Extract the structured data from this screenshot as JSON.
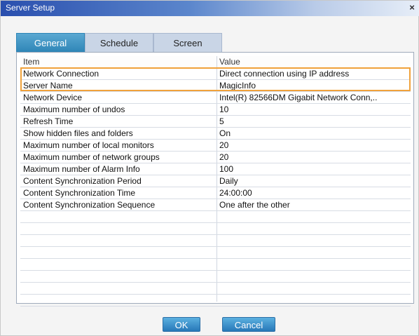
{
  "window": {
    "title": "Server Setup",
    "close_glyph": "×"
  },
  "tabs": [
    {
      "label": "General"
    },
    {
      "label": "Schedule"
    },
    {
      "label": "Screen"
    }
  ],
  "table": {
    "columns": [
      "Item",
      "Value"
    ],
    "rows": [
      {
        "item": "Network Connection",
        "value": "Direct connection using IP address"
      },
      {
        "item": "Server Name",
        "value": "MagicInfo"
      },
      {
        "item": "Network Device",
        "value": "Intel(R) 82566DM Gigabit Network Conn,.."
      },
      {
        "item": "Maximum number of undos",
        "value": "10"
      },
      {
        "item": "Refresh Time",
        "value": "5"
      },
      {
        "item": "Show hidden files and folders",
        "value": "On"
      },
      {
        "item": "Maximum number of local monitors",
        "value": "20"
      },
      {
        "item": "Maximum number of network groups",
        "value": "20"
      },
      {
        "item": "Maximum number of Alarm Info",
        "value": "100"
      },
      {
        "item": "Content Synchronization Period",
        "value": "Daily"
      },
      {
        "item": "Content Synchronization Time",
        "value": "24:00:00"
      },
      {
        "item": "Content Synchronization Sequence",
        "value": "One after the other"
      }
    ]
  },
  "buttons": {
    "ok": "OK",
    "cancel": "Cancel"
  },
  "colors": {
    "accent": "#2f86b7",
    "highlight": "#f0a23b"
  },
  "icons": {
    "close": "close-icon"
  }
}
